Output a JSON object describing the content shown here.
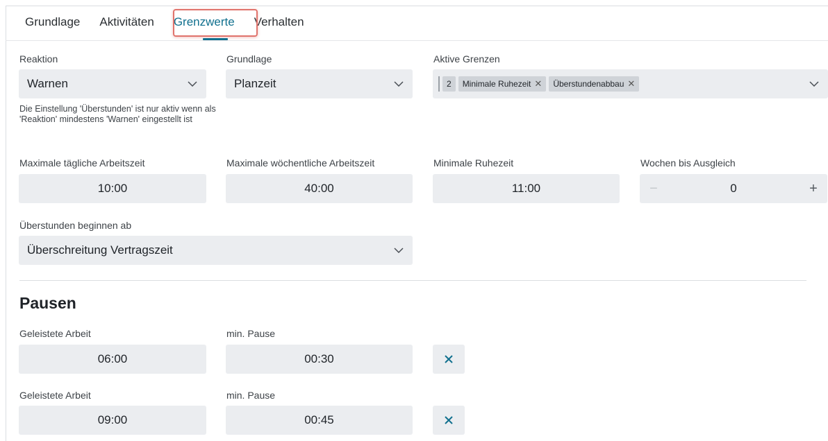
{
  "tabs": [
    {
      "label": "Grundlage",
      "active": false
    },
    {
      "label": "Aktivitäten",
      "active": false
    },
    {
      "label": "Grenzwerte",
      "active": true
    },
    {
      "label": "Verhalten",
      "active": false
    }
  ],
  "form": {
    "reaktion": {
      "label": "Reaktion",
      "value": "Warnen"
    },
    "grundlage": {
      "label": "Grundlage",
      "value": "Planzeit"
    },
    "aktive_grenzen": {
      "label": "Aktive Grenzen",
      "count": "2",
      "chips": [
        "Minimale Ruhezeit",
        "Überstundenabbau"
      ]
    },
    "hint": "Die Einstellung 'Überstunden' ist nur aktiv wenn als 'Reaktion' mindestens 'Warnen' eingestellt ist",
    "max_taeglich": {
      "label": "Maximale tägliche Arbeitszeit",
      "value": "10:00"
    },
    "max_woechentlich": {
      "label": "Maximale wöchentliche Arbeitszeit",
      "value": "40:00"
    },
    "min_ruhezeit": {
      "label": "Minimale Ruhezeit",
      "value": "11:00"
    },
    "wochen_ausgleich": {
      "label": "Wochen bis Ausgleich",
      "value": "0",
      "minus": "−",
      "plus": "+"
    },
    "ueberstunden": {
      "label": "Überstunden beginnen ab",
      "value": "Überschreitung Vertragszeit"
    }
  },
  "pausen": {
    "title": "Pausen",
    "rows": [
      {
        "arbeit_label": "Geleistete Arbeit",
        "arbeit": "06:00",
        "pause_label": "min. Pause",
        "pause": "00:30"
      },
      {
        "arbeit_label": "Geleistete Arbeit",
        "arbeit": "09:00",
        "pause_label": "min. Pause",
        "pause": "00:45"
      }
    ]
  },
  "colors": {
    "accent": "#11708e",
    "field_bg": "#ebedf0",
    "tab_highlight": "#e0736c"
  },
  "icons": {
    "chevron": "chevron-down-icon",
    "remove": "close-icon"
  }
}
